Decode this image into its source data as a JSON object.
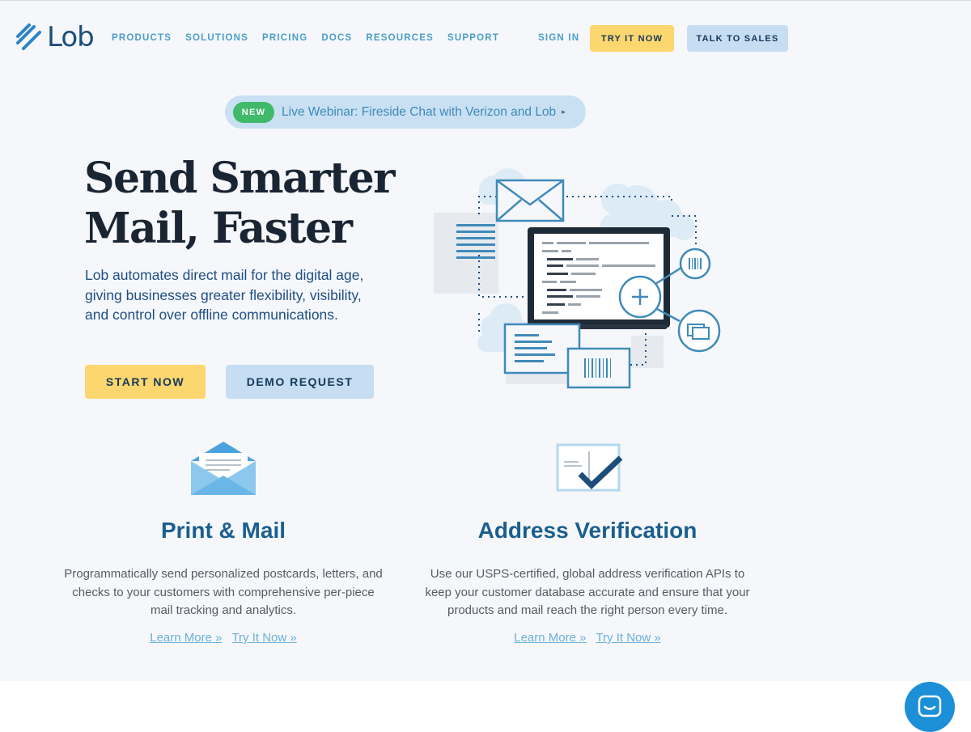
{
  "header": {
    "logo_text": "Lob",
    "nav": [
      "PRODUCTS",
      "SOLUTIONS",
      "PRICING",
      "DOCS",
      "RESOURCES",
      "SUPPORT"
    ],
    "sign_in": "SIGN IN",
    "try_it_now": "TRY IT NOW",
    "talk_to_sales": "TALK TO SALES"
  },
  "announcement": {
    "badge": "NEW",
    "text": "Live Webinar: Fireside Chat with Verizon and Lob",
    "arrow": "▸"
  },
  "hero": {
    "title_line1": "Send Smarter",
    "title_line2": "Mail, Faster",
    "subtitle": "Lob automates direct mail for the digital age, giving businesses greater flexibility, visibility, and control over offline communications.",
    "start_button": "START NOW",
    "demo_button": "DEMO REQUEST"
  },
  "features": [
    {
      "title": "Print & Mail",
      "description": "Programmatically send personalized postcards, letters, and checks to your customers with comprehensive per-piece mail tracking and analytics.",
      "learn_more": "Learn More »",
      "try_it_now": "Try It Now »",
      "icon": "envelope-icon"
    },
    {
      "title": "Address Verification",
      "description": "Use our USPS-certified, global address verification APIs to keep your customer database accurate and ensure that your products and mail reach the right person every time.",
      "learn_more": "Learn More »",
      "try_it_now": "Try It Now »",
      "icon": "checkmark-document-icon"
    }
  ],
  "colors": {
    "nav_text": "#4a9ec9",
    "yellow_button": "#fcd66e",
    "blue_button": "#c6ddf2",
    "headline": "#1a2533",
    "feature_title": "#1b5f8e",
    "new_badge": "#3fb96a",
    "chat_button": "#1d8fd6"
  }
}
